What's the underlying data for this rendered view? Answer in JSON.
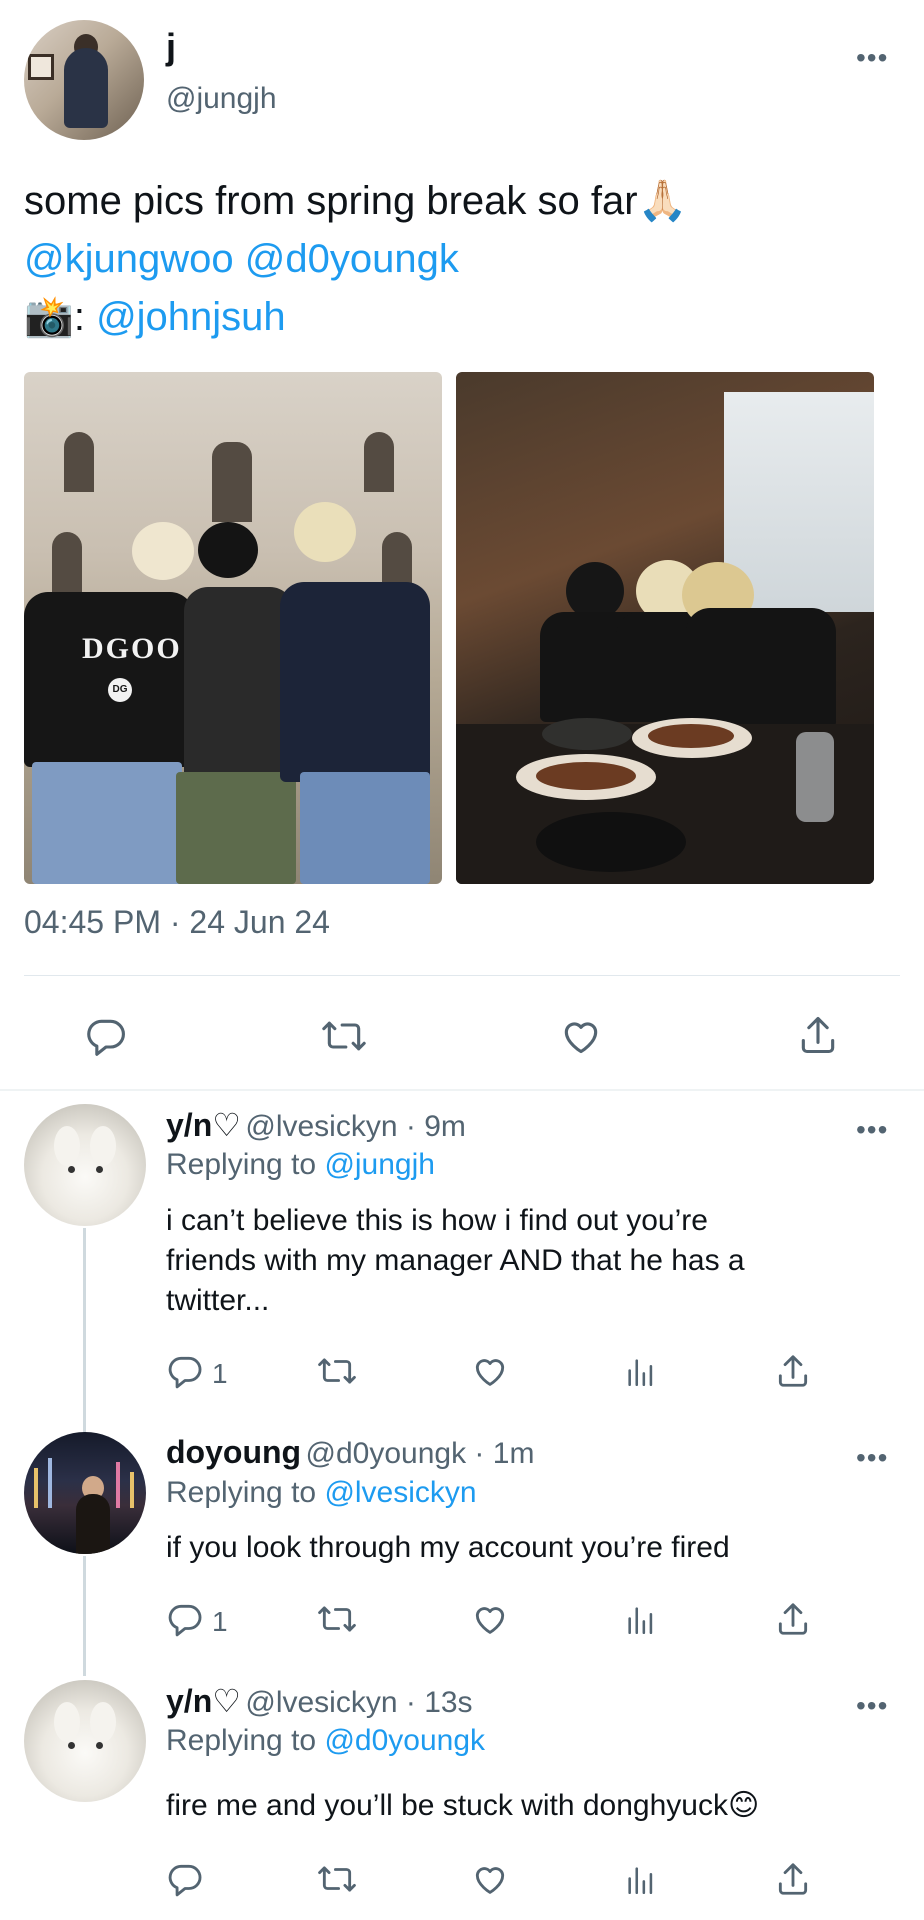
{
  "tweet": {
    "author_name": "j",
    "author_handle": "@jungjh",
    "text_line1": "some pics from spring break so far🙏🏻",
    "mention1": "@kjungwoo",
    "mention2": "@d0youngk",
    "camera_emoji": "📸",
    "credit_colon": ":",
    "mention3": "@johnjsuh",
    "timestamp": "04:45 PM · 24 Jun 24",
    "more": "•••",
    "photo1_shirt_text": "DGOO",
    "photo1_logo_text": "DG"
  },
  "replies": [
    {
      "name": "y/n♡",
      "meta": "@lvesickyn · 9m",
      "replying_prefix": "Replying to",
      "replying_to": "@jungjh",
      "lines": [
        "i can’t believe this is how i find out you’re",
        "friends with my manager AND that he has a",
        "twitter..."
      ],
      "reply_count": "1",
      "more": "•••"
    },
    {
      "name": "doyoung",
      "meta": "@d0youngk · 1m",
      "replying_prefix": "Replying to",
      "replying_to": "@lvesickyn",
      "lines": [
        "if you look through my account you’re fired"
      ],
      "reply_count": "1",
      "more": "•••"
    },
    {
      "name": "y/n♡",
      "meta": "@lvesickyn · 13s",
      "replying_prefix": "Replying to",
      "replying_to": "@d0youngk",
      "lines": [
        "fire me and you’ll be stuck with donghyuck😊"
      ],
      "reply_count": "",
      "more": "•••"
    }
  ],
  "icons": [
    "reply-icon",
    "retweet-icon",
    "like-icon",
    "views-icon",
    "share-icon",
    "more-icon"
  ],
  "colors": {
    "link": "#1d9bf0",
    "secondary": "#536471",
    "text": "#0f1419"
  }
}
